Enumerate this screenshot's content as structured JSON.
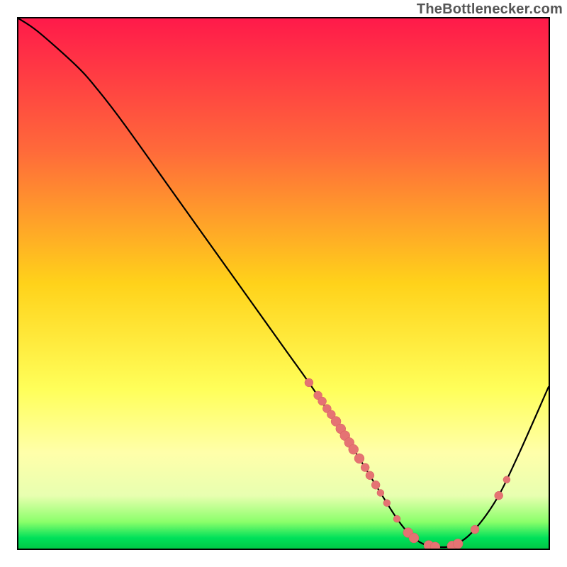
{
  "watermark": "TheBottlenecker.com",
  "colors": {
    "marker_fill": "#e57373",
    "marker_stroke": "#d45f5f",
    "curve_stroke": "#000000"
  },
  "chart_data": {
    "type": "line",
    "title": "",
    "xlabel": "",
    "ylabel": "",
    "xlim": [
      0,
      100
    ],
    "ylim": [
      0,
      100
    ],
    "curve_points": [
      {
        "x": 0.0,
        "y": 100.0
      },
      {
        "x": 3.7,
        "y": 97.5
      },
      {
        "x": 11.0,
        "y": 91.0
      },
      {
        "x": 15.0,
        "y": 86.5
      },
      {
        "x": 20.0,
        "y": 80.0
      },
      {
        "x": 30.0,
        "y": 66.0
      },
      {
        "x": 40.0,
        "y": 52.0
      },
      {
        "x": 50.0,
        "y": 38.0
      },
      {
        "x": 55.0,
        "y": 31.0
      },
      {
        "x": 60.0,
        "y": 23.5
      },
      {
        "x": 64.0,
        "y": 17.5
      },
      {
        "x": 68.0,
        "y": 11.0
      },
      {
        "x": 71.5,
        "y": 5.5
      },
      {
        "x": 74.0,
        "y": 2.5
      },
      {
        "x": 76.5,
        "y": 0.8
      },
      {
        "x": 79.0,
        "y": 0.3
      },
      {
        "x": 82.0,
        "y": 0.6
      },
      {
        "x": 85.5,
        "y": 3.0
      },
      {
        "x": 90.0,
        "y": 9.0
      },
      {
        "x": 94.0,
        "y": 17.0
      },
      {
        "x": 100.0,
        "y": 30.5
      }
    ],
    "markers": [
      {
        "x": 54.8,
        "y": 31.3,
        "r": 6
      },
      {
        "x": 56.5,
        "y": 28.9,
        "r": 6
      },
      {
        "x": 57.3,
        "y": 27.8,
        "r": 6
      },
      {
        "x": 58.2,
        "y": 26.4,
        "r": 6
      },
      {
        "x": 59.0,
        "y": 25.3,
        "r": 6
      },
      {
        "x": 59.9,
        "y": 24.0,
        "r": 7
      },
      {
        "x": 60.8,
        "y": 22.6,
        "r": 7
      },
      {
        "x": 61.6,
        "y": 21.3,
        "r": 7
      },
      {
        "x": 62.4,
        "y": 20.0,
        "r": 7
      },
      {
        "x": 63.2,
        "y": 18.7,
        "r": 7
      },
      {
        "x": 64.3,
        "y": 17.0,
        "r": 7
      },
      {
        "x": 65.4,
        "y": 15.3,
        "r": 6
      },
      {
        "x": 66.3,
        "y": 13.8,
        "r": 6
      },
      {
        "x": 67.4,
        "y": 12.0,
        "r": 6
      },
      {
        "x": 68.3,
        "y": 10.5,
        "r": 5
      },
      {
        "x": 69.5,
        "y": 8.6,
        "r": 5
      },
      {
        "x": 71.4,
        "y": 5.6,
        "r": 5
      },
      {
        "x": 73.5,
        "y": 3.0,
        "r": 7
      },
      {
        "x": 74.6,
        "y": 2.0,
        "r": 7
      },
      {
        "x": 77.4,
        "y": 0.6,
        "r": 7
      },
      {
        "x": 78.6,
        "y": 0.3,
        "r": 7
      },
      {
        "x": 81.8,
        "y": 0.5,
        "r": 7
      },
      {
        "x": 82.9,
        "y": 0.9,
        "r": 7
      },
      {
        "x": 86.1,
        "y": 3.6,
        "r": 6
      },
      {
        "x": 90.6,
        "y": 10.0,
        "r": 6
      },
      {
        "x": 92.1,
        "y": 13.0,
        "r": 5
      }
    ]
  }
}
